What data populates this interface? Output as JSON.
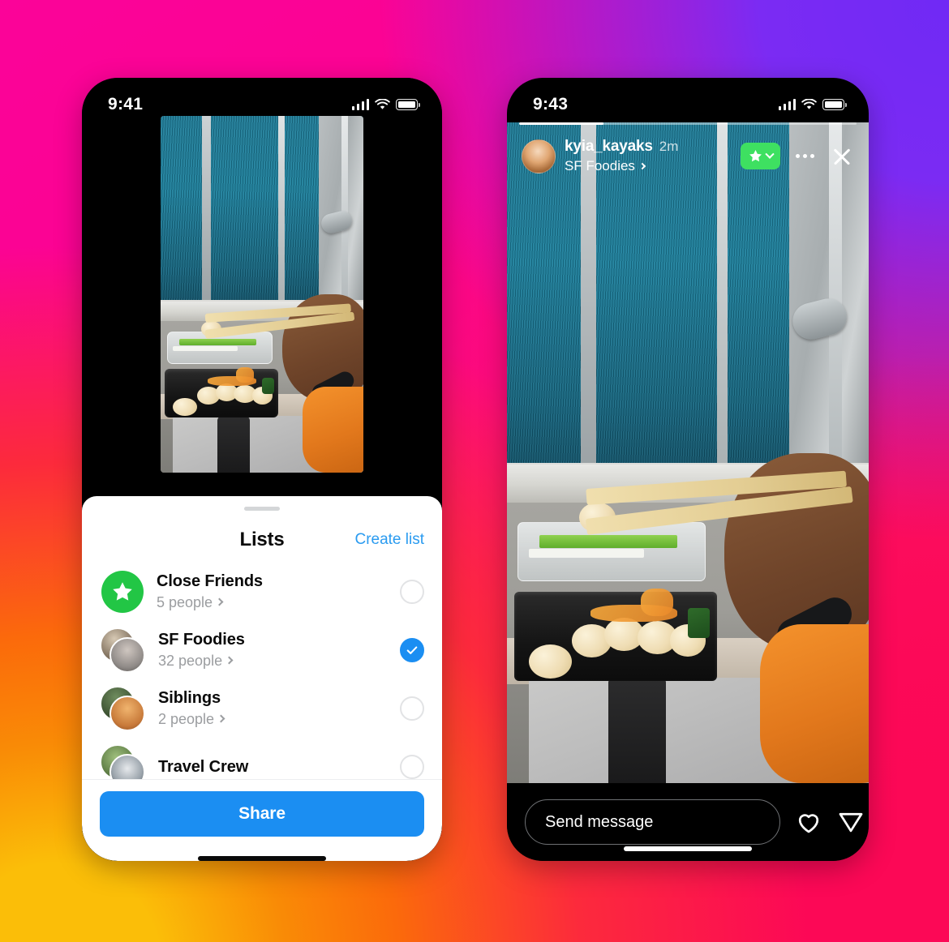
{
  "background": {
    "gradient_colors": [
      "#FB0399",
      "#7029F5",
      "#FC0856",
      "#FBBE08",
      "#FB6A0B"
    ]
  },
  "left_phone": {
    "status_bar": {
      "time": "9:41",
      "cellular_icon": "signal-bars-icon",
      "wifi_icon": "wifi-icon",
      "battery_icon": "battery-full-icon"
    },
    "media": {
      "description": "Photo of a person holding chopsticks over a tray of sushi on a train seat tray table",
      "alt_name": "story-photo-preview"
    },
    "sheet": {
      "grabber": "drag-handle",
      "title": "Lists",
      "create_list_label": "Create list",
      "items": [
        {
          "name": "Close Friends",
          "count_label": "5 people",
          "icon": "green-star-icon",
          "icon_color": "#22C645",
          "selected": false
        },
        {
          "name": "SF Foodies",
          "count_label": "32 people",
          "icon": "avatar-stack",
          "selected": true
        },
        {
          "name": "Siblings",
          "count_label": "2 people",
          "icon": "avatar-stack",
          "selected": false
        },
        {
          "name": "Travel Crew",
          "count_label": "",
          "icon": "avatar-stack",
          "selected": false
        }
      ],
      "share_button_label": "Share",
      "share_button_color": "#1B8EF2",
      "accent_link_color": "#2A9BF0"
    }
  },
  "right_phone": {
    "status_bar": {
      "time": "9:43",
      "cellular_icon": "signal-bars-icon",
      "wifi_icon": "wifi-icon",
      "battery_icon": "battery-full-icon"
    },
    "story": {
      "progress_percent": 25,
      "avatar": "user-avatar",
      "username": "kyia_kayaks",
      "timestamp": "2m",
      "list_label": "SF Foodies",
      "list_chevron": "chevron-right-icon",
      "close_friends_badge": {
        "icon": "star-icon",
        "chevron": "chevron-down-icon",
        "color": "#3EE061"
      },
      "more_icon": "more-horizontal-icon",
      "close_icon": "close-icon",
      "media_description": "Photo of a person holding chopsticks over a tray of sushi on a train seat tray table"
    },
    "footer": {
      "message_placeholder": "Send message",
      "like_icon": "heart-icon",
      "share_icon": "paper-plane-icon"
    }
  }
}
